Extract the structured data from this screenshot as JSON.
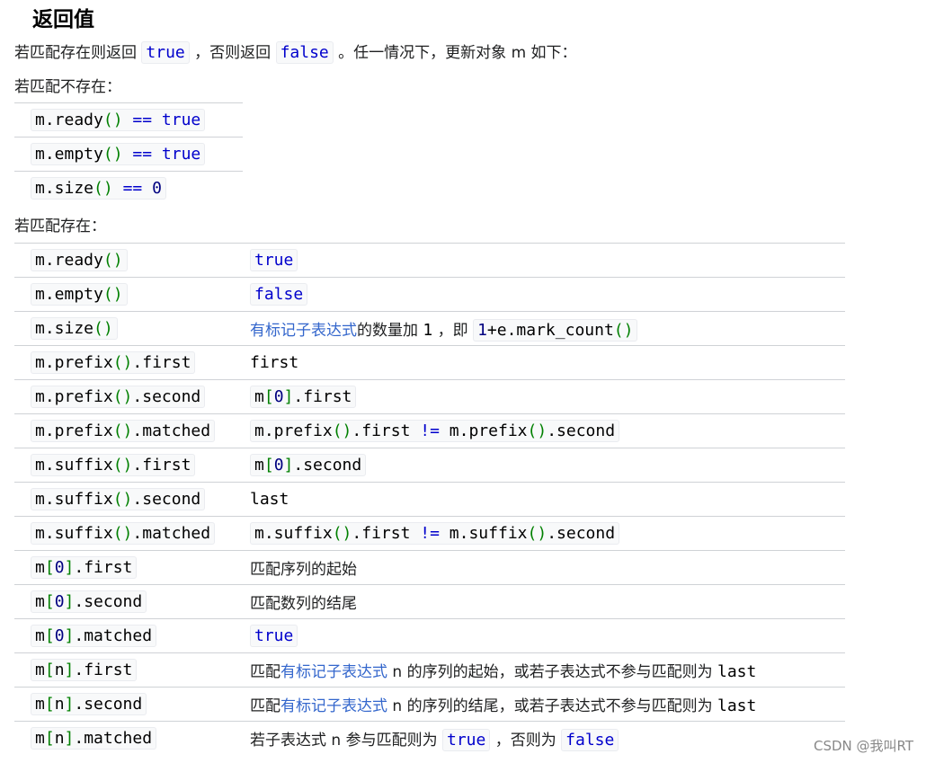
{
  "heading": "返回值",
  "intro": {
    "t1": "若匹配存在则返回",
    "v_true": "true",
    "t2": "，否则返回",
    "v_false": "false",
    "t3": "。任一情况下，更新对象",
    "var_m": "m",
    "t4": "如下："
  },
  "not_exist_label": "若匹配不存在：",
  "exist_label": "若匹配存在：",
  "not_exist_rows": [
    {
      "a": "m.ready",
      "p": "()",
      "op": "==",
      "v": "true"
    },
    {
      "a": "m.empty",
      "p": "()",
      "op": "==",
      "v": "true"
    },
    {
      "a": "m.size",
      "p": "()",
      "op": "==",
      "v": "0"
    }
  ],
  "exist_rows": {
    "r0": {
      "a": "m.ready",
      "p": "()",
      "v": "true"
    },
    "r1": {
      "a": "m.empty",
      "p": "()",
      "v": "false"
    },
    "r2": {
      "a": "m.size",
      "p": "()",
      "link": "有标记子表达式",
      "t1": "的数量加",
      "n": "1",
      "t2": "，即",
      "c_num": "1",
      "c_op": "+",
      "c_rest": "e.mark_count",
      "c_p": "()"
    },
    "r3": {
      "a": "m.prefix",
      "p": "()",
      "b": ".first",
      "v": "first"
    },
    "r4": {
      "a": "m.prefix",
      "p": "()",
      "b": ".second",
      "c1": "m",
      "c2": "[",
      "c3": "0",
      "c4": "]",
      "c5": ".first"
    },
    "r5": {
      "a": "m.prefix",
      "p": "()",
      "b": ".matched",
      "v1": "m.prefix",
      "v2": "()",
      "v3": ".first",
      "v4": "!=",
      "v5": "m.prefix",
      "v6": "()",
      "v7": ".second"
    },
    "r6": {
      "a": "m.suffix",
      "p": "()",
      "b": ".first",
      "c1": "m",
      "c2": "[",
      "c3": "0",
      "c4": "]",
      "c5": ".second"
    },
    "r7": {
      "a": "m.suffix",
      "p": "()",
      "b": ".second",
      "v": "last"
    },
    "r8": {
      "a": "m.suffix",
      "p": "()",
      "b": ".matched",
      "v1": "m.suffix",
      "v2": "()",
      "v3": ".first",
      "v4": "!=",
      "v5": "m.suffix",
      "v6": "()",
      "v7": ".second"
    },
    "r9": {
      "a": "m",
      "l": "[",
      "n": "0",
      "r": "]",
      "b": ".first",
      "v": "匹配序列的起始"
    },
    "r10": {
      "a": "m",
      "l": "[",
      "n": "0",
      "r": "]",
      "b": ".second",
      "v": "匹配数列的结尾"
    },
    "r11": {
      "a": "m",
      "l": "[",
      "n": "0",
      "r": "]",
      "b": ".matched",
      "v": "true"
    },
    "r12": {
      "a": "m",
      "l": "[",
      "n": "n",
      "r": "]",
      "b": ".first",
      "t1": "匹配",
      "link": "有标记子表达式",
      "var": "n",
      "t2": "的序列的起始，或若子表达式不参与匹配则为",
      "end": "last"
    },
    "r13": {
      "a": "m",
      "l": "[",
      "n": "n",
      "r": "]",
      "b": ".second",
      "t1": "匹配",
      "link": "有标记子表达式",
      "var": "n",
      "t2": "的序列的结尾，或若子表达式不参与匹配则为",
      "end": "last"
    },
    "r14": {
      "a": "m",
      "l": "[",
      "n": "n",
      "r": "]",
      "b": ".matched",
      "t1": "若子表达式",
      "var": "n",
      "t2": "参与匹配则为",
      "v_true": "true",
      "t3": "，否则为",
      "v_false": "false"
    }
  },
  "watermark": "CSDN @我叫RT"
}
